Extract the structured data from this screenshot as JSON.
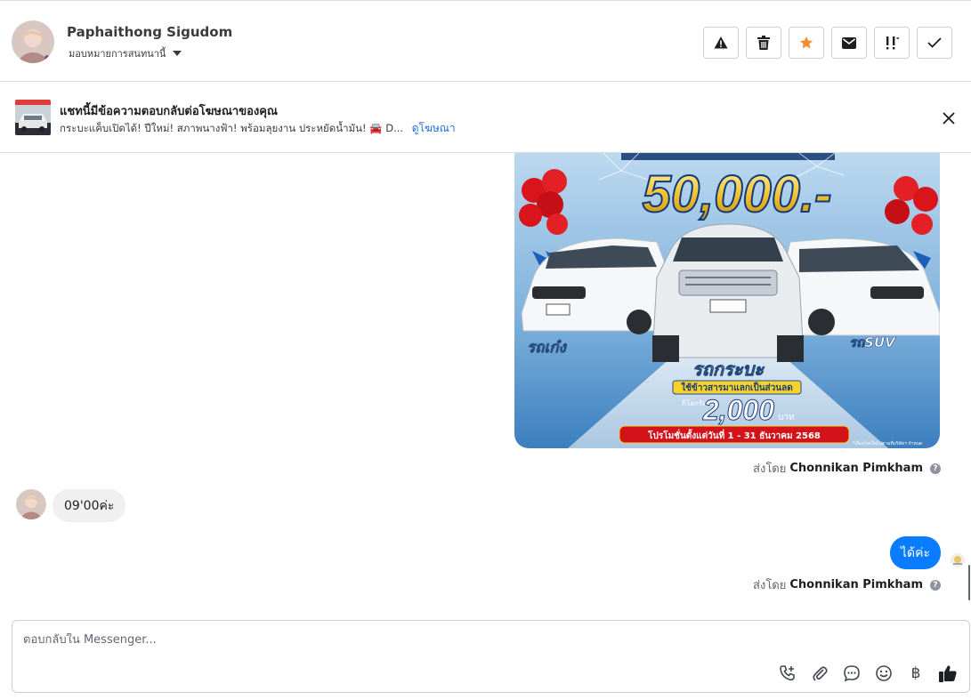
{
  "header": {
    "contact_name": "Paphaithong Sigudom",
    "assign_label": "มอบหมายการสนทนานี้",
    "actions": [
      {
        "name": "report-icon"
      },
      {
        "name": "trash-icon"
      },
      {
        "name": "star-icon",
        "color": "#f58d2c"
      },
      {
        "name": "envelope-icon"
      },
      {
        "name": "follow-up-icon"
      },
      {
        "name": "check-icon"
      }
    ]
  },
  "ad_banner": {
    "title": "แชทนี้มีข้อความตอบกลับต่อโฆษณาของคุณ",
    "subtitle": "กระบะแค็บเปิดได้! ปีใหม่! สภาพนางฟ้า! พร้อมลุยงาน ประหยัดน้ำมัน! 🚘 D...",
    "link": "ดูโฆษณา"
  },
  "promo_image": {
    "price": "50,000.-",
    "label_left": "รถเก๋ง",
    "label_right": "รถSUV",
    "label_center": "รถกระบะ",
    "rice_text": "ใช้ข้าวสารมาแลกเป็นส่วนลด",
    "per_kg": "กิโลกรัมละ",
    "amount": "2,000",
    "unit": "บาท",
    "promo_period": "โปรโมชั่นตั้งแต่วันที่ 1 - 31 ธันวาคม 2568",
    "footnote": "*เงื่อนไขเป็นไปตามที่บริษัทฯ กำหนด"
  },
  "messages": {
    "sent_by_prefix": "ส่งโดย",
    "sender_1": "Chonnikan Pimkham",
    "incoming_1": "09'00ค่ะ",
    "outgoing_1": "ได้ค่ะ",
    "sender_2": "Chonnikan Pimkham"
  },
  "composer": {
    "placeholder": "ตอบกลับใน Messenger...",
    "value": "",
    "baht_symbol": "฿"
  },
  "colors": {
    "accent": "#0a7cff",
    "link": "#216fdb",
    "star": "#f58d2c"
  }
}
